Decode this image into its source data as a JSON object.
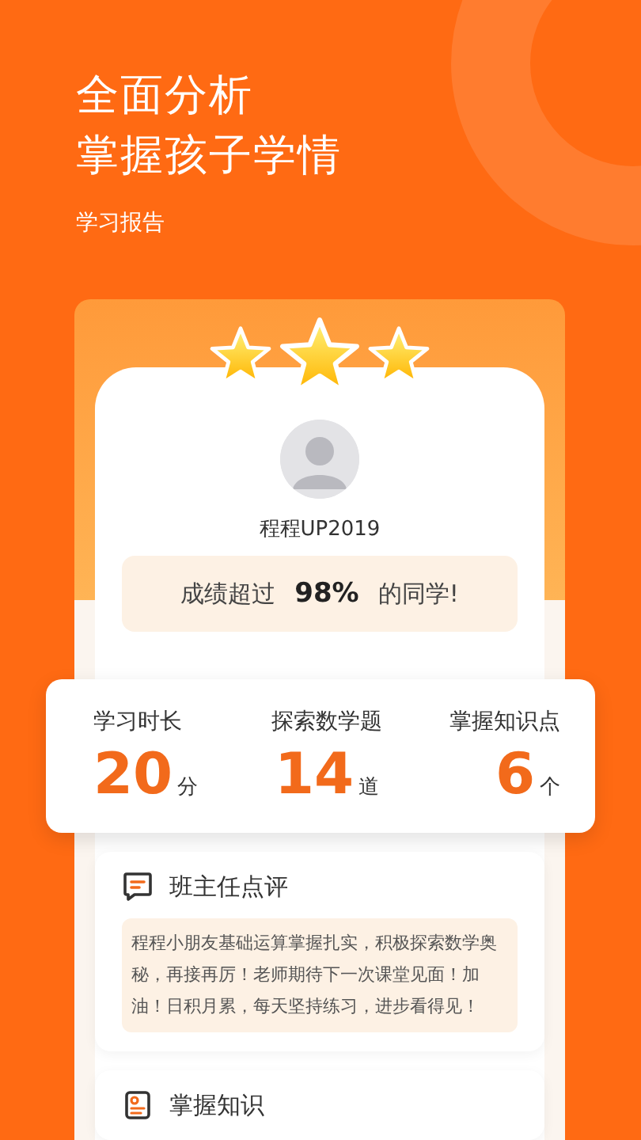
{
  "headline": [
    "全面分析",
    "掌握孩子学情"
  ],
  "subtitle": "学习报告",
  "report": {
    "stars": 3,
    "student_name": "程程UP2019",
    "rank": {
      "prefix": "成绩超过",
      "value": "98%",
      "suffix": "的同学!"
    },
    "stats": [
      {
        "label": "学习时长",
        "value": "20",
        "unit": "分"
      },
      {
        "label": "探索数学题",
        "value": "14",
        "unit": "道"
      },
      {
        "label": "掌握知识点",
        "value": "6",
        "unit": "个"
      }
    ],
    "comment": {
      "title": "班主任点评",
      "text": "程程小朋友基础运算掌握扎实，积极探索数学奥秘，再接再厉！老师期待下一次课堂见面！加油！日积月累，每天坚持练习，进步看得见！"
    },
    "next_section": {
      "title": "掌握知识"
    }
  }
}
